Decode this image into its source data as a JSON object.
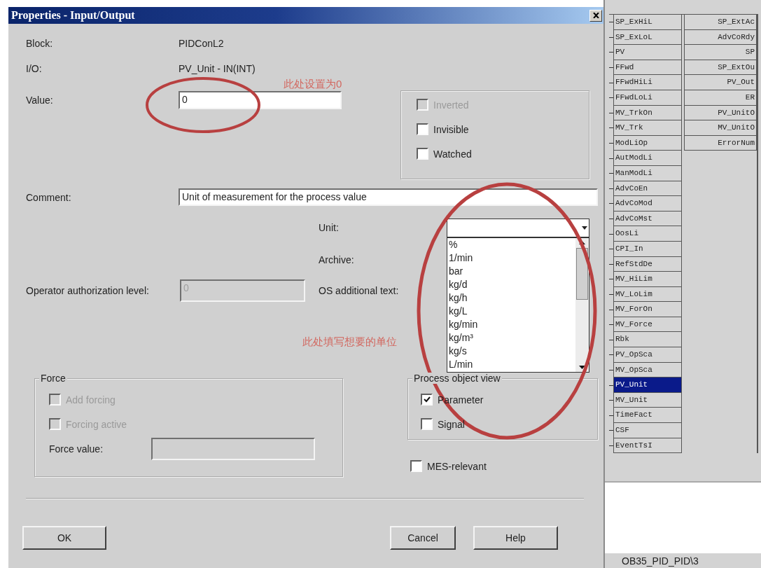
{
  "dialog": {
    "title": "Properties - Input/Output",
    "block": {
      "label": "Block:",
      "value": "PIDConL2"
    },
    "io": {
      "label": "I/O:",
      "value": "PV_Unit - IN(INT)"
    },
    "value": {
      "label": "Value:",
      "value": "0"
    },
    "options": [
      {
        "label": "Inverted",
        "checked": false,
        "disabled": true
      },
      {
        "label": "Invisible",
        "checked": false,
        "disabled": false
      },
      {
        "label": "Watched",
        "checked": false,
        "disabled": false
      }
    ],
    "comment": {
      "label": "Comment:",
      "value": "Unit of measurement for the process value"
    },
    "unit": {
      "label": "Unit:",
      "expanded": true,
      "list": [
        "%",
        "1/min",
        "bar",
        "kg/d",
        "kg/h",
        "kg/L",
        "kg/min",
        "kg/m³",
        "kg/s",
        "L/min"
      ]
    },
    "archive": {
      "label": "Archive:"
    },
    "operator_level": {
      "label": "Operator authorization level:",
      "value": "0",
      "disabled": true
    },
    "os_text": {
      "label": "OS additional text:"
    },
    "force": {
      "title": "Force",
      "options": [
        {
          "label": "Add forcing",
          "checked": false,
          "disabled": true
        },
        {
          "label": "Forcing active",
          "checked": false,
          "disabled": true
        }
      ],
      "value_label": "Force value:",
      "value_disabled": true
    },
    "process_object_view": {
      "title": "Process object view",
      "options": [
        {
          "label": "Parameter",
          "checked": true,
          "disabled": false
        },
        {
          "label": "Signal",
          "checked": false,
          "disabled": false
        }
      ]
    },
    "mes_relevant": {
      "label": "MES-relevant",
      "checked": false,
      "disabled": false
    },
    "buttons": [
      "OK",
      "Cancel",
      "Help"
    ]
  },
  "annotations": [
    "此处设置为0",
    "此处填写想要的单位"
  ],
  "block_diagram": {
    "inputs": [
      {
        "label": "SP_ExHiL",
        "selected": false
      },
      {
        "label": "SP_ExLoL",
        "selected": false
      },
      {
        "label": "PV",
        "selected": false
      },
      {
        "label": "FFwd",
        "selected": false
      },
      {
        "label": "FFwdHiLi",
        "selected": false
      },
      {
        "label": "FFwdLoLi",
        "selected": false
      },
      {
        "label": "MV_TrkOn",
        "selected": false
      },
      {
        "label": "MV_Trk",
        "selected": false
      },
      {
        "label": "ModLiOp",
        "selected": false
      },
      {
        "label": "AutModLi",
        "selected": false
      },
      {
        "label": "ManModLi",
        "selected": false
      },
      {
        "label": "AdvCoEn",
        "selected": false
      },
      {
        "label": "AdvCoMod",
        "selected": false
      },
      {
        "label": "AdvCoMst",
        "selected": false
      },
      {
        "label": "OosLi",
        "selected": false
      },
      {
        "label": "CPI_In",
        "selected": false
      },
      {
        "label": "RefStdDe",
        "selected": false
      },
      {
        "label": "MV_HiLim",
        "selected": false
      },
      {
        "label": "MV_LoLim",
        "selected": false
      },
      {
        "label": "MV_ForOn",
        "selected": false
      },
      {
        "label": "MV_Force",
        "selected": false
      },
      {
        "label": "Rbk",
        "selected": false
      },
      {
        "label": "PV_OpSca",
        "selected": false
      },
      {
        "label": "MV_OpSca",
        "selected": false
      },
      {
        "label": "PV_Unit",
        "selected": true
      },
      {
        "label": "MV_Unit",
        "selected": false
      },
      {
        "label": "TimeFact",
        "selected": false
      },
      {
        "label": "CSF",
        "selected": false
      },
      {
        "label": "EventTsI",
        "selected": false
      }
    ],
    "outputs": [
      "SP_ExtAc",
      "AdvCoRdy",
      "SP",
      "SP_ExtOu",
      "PV_Out",
      "ER",
      "PV_UnitO",
      "MV_UnitO",
      "ErrorNum"
    ]
  },
  "status_bar": {
    "text": "OB35_PID_PID\\3"
  }
}
